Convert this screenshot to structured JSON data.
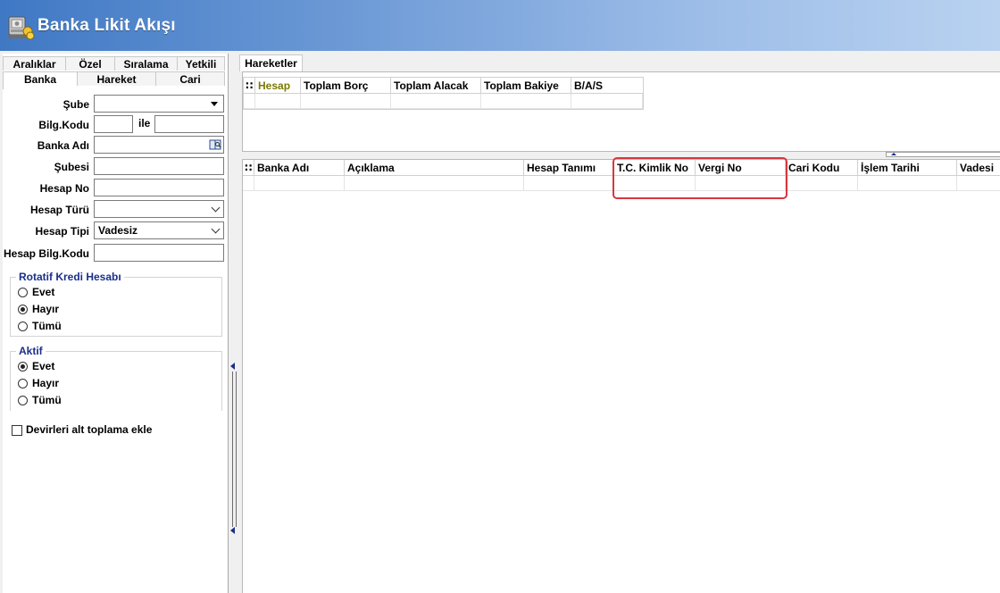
{
  "window": {
    "title": "Banka Likit Akışı",
    "icon": "bank-safe-icon"
  },
  "left_tabs": {
    "row1": [
      "Aralıklar",
      "Özel",
      "Sıralama",
      "Yetkili"
    ],
    "row2": [
      "Banka",
      "Hareket",
      "Cari"
    ],
    "active": "Banka"
  },
  "filters": {
    "sube_label": "Şube",
    "bilg_kodu_label": "Bilg.Kodu",
    "ile_label": "ile",
    "banka_adi_label": "Banka Adı",
    "subesi_label": "Şubesi",
    "hesap_no_label": "Hesap No",
    "hesap_turu_label": "Hesap Türü",
    "hesap_tipi_label": "Hesap Tipi",
    "hesap_tipi_value": "Vadesiz",
    "hesap_bilg_kodu_label": "Hesap Bilg.Kodu"
  },
  "rotatif": {
    "title": "Rotatif Kredi Hesabı",
    "options": [
      "Evet",
      "Hayır",
      "Tümü"
    ],
    "selected": "Hayır"
  },
  "aktif": {
    "title": "Aktif",
    "options": [
      "Evet",
      "Hayır",
      "Tümü"
    ],
    "selected": "Evet"
  },
  "devirleri_label": "Devirleri alt toplama ekle",
  "right_tab": "Hareketler",
  "summary_grid": {
    "columns": [
      "Hesap",
      "Toplam Borç",
      "Toplam Alacak",
      "Toplam Bakiye",
      "B/A/S"
    ],
    "highlight_color": "#7a7a00"
  },
  "detail_grid": {
    "columns": [
      "Banka Adı",
      "Açıklama",
      "Hesap Tanımı",
      "T.C. Kimlik No",
      "Vergi No",
      "Cari Kodu",
      "İşlem Tarihi",
      "Vadesi"
    ]
  },
  "colors": {
    "titlebar_start": "#3f78c4",
    "titlebar_end": "#b9d2f0",
    "group_title": "#1a2f8a",
    "highlight_box": "#d9363e"
  }
}
